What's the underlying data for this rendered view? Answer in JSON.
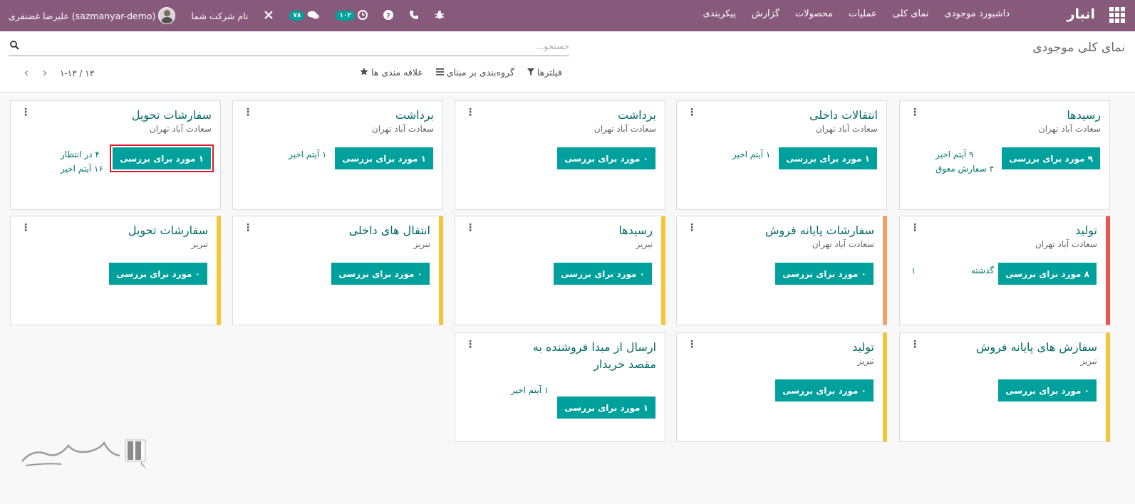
{
  "navbar": {
    "brand": "انبار",
    "menu": [
      "داشبورد موجودی",
      "نمای کلی",
      "عملیات",
      "محصولات",
      "گزارش",
      "پیکربندی"
    ],
    "user_name": "علیرضا غضنفری (sazmanyar-demo)",
    "company": "نام شرکت شما",
    "messages_count": "۷۸",
    "activities_count": "۱۰۲",
    "accent_color": "#875a7b"
  },
  "control": {
    "title": "نمای کلی موجودی",
    "search_placeholder": "جستجو...",
    "filters": "فیلترها",
    "group_by": "گروه‌بندی بر مبنای",
    "favorites": "علاقه مندی ها",
    "pager": "۱-۱۳ / ۱۳"
  },
  "cards": [
    {
      "title": "رسیدها",
      "sub": "سعادت آباد تهران",
      "button": "۹ مورد برای بررسی",
      "info": [
        "۹ آیتم اخیر",
        "۲ سفارش معوق"
      ]
    },
    {
      "title": "انتقالات داخلی",
      "sub": "سعادت آباد تهران",
      "button": "۱ مورد برای بررسی",
      "info": [
        "۱ آیتم اخیر"
      ]
    },
    {
      "title": "برداشت",
      "sub": "سعادت آباد تهران",
      "button": "۰ مورد برای بررسی",
      "info": []
    },
    {
      "title": "برداشت",
      "sub": "سعادت آباد تهران",
      "button": "۱ مورد برای بررسی",
      "info": [
        "۱ آیتم اخیر"
      ]
    },
    {
      "title": "سفارشات تحویل",
      "sub": "سعادت آباد تهران",
      "button": "۱ مورد برای بررسی",
      "info": [
        "۴ در انتظار",
        "۱۶ آیتم اخیر"
      ]
    },
    {
      "title": "تولید",
      "sub": "سعادت آباد تهران",
      "button": "۸ مورد برای بررسی",
      "info": [
        "گذشته",
        "۱"
      ]
    },
    {
      "title": "سفارشات پایانه فروش",
      "sub": "سعادت آباد تهران",
      "button": "۰ مورد برای بررسی",
      "info": []
    },
    {
      "title": "رسیدها",
      "sub": "تبریز",
      "button": "۰ مورد برای بررسی",
      "info": []
    },
    {
      "title": "انتقال های داخلی",
      "sub": "تبریز",
      "button": "۰ مورد برای بررسی",
      "info": []
    },
    {
      "title": "سفارشات تحویل",
      "sub": "تبریز",
      "button": "۰ مورد برای بررسی",
      "info": []
    },
    {
      "title": "سفارش های پایانه فروش",
      "sub": "تبریز",
      "button": "۰ مورد برای بررسی",
      "info": []
    },
    {
      "title": "تولید",
      "sub": "تبریز",
      "button": "۰ مورد برای بررسی",
      "info": []
    },
    {
      "title": "ارسال از مبدا فروشنده به مقصد خریدار",
      "sub": "",
      "button": "۱ مورد برای بررسی",
      "info": [
        "۱ آیتم اخیر"
      ]
    }
  ],
  "colors": {
    "button": "#00a09d",
    "title": "#016a66",
    "yellow": "#f4c534",
    "orange": "#f0a062",
    "red": "#e8584e"
  }
}
